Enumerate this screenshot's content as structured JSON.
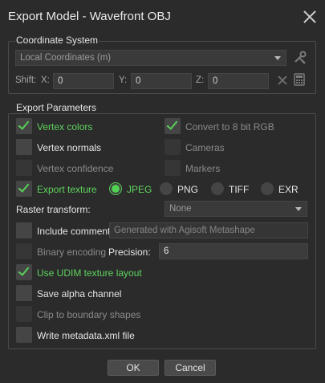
{
  "window": {
    "title": "Export Model - Wavefront OBJ"
  },
  "coordinate_system": {
    "title": "Coordinate System",
    "selected": "Local Coordinates (m)",
    "shift_label": "Shift:",
    "x_label": "X:",
    "x_value": "0",
    "y_label": "Y:",
    "y_value": "0",
    "z_label": "Z:",
    "z_value": "0"
  },
  "export_parameters": {
    "title": "Export Parameters",
    "vertex_colors": {
      "label": "Vertex colors",
      "checked": true
    },
    "convert_8bit": {
      "label": "Convert to 8 bit RGB",
      "checked": true
    },
    "vertex_normals": {
      "label": "Vertex normals",
      "checked": false
    },
    "cameras": {
      "label": "Cameras",
      "checked": false
    },
    "vertex_confidence": {
      "label": "Vertex confidence",
      "checked": false
    },
    "markers": {
      "label": "Markers",
      "checked": false
    },
    "export_texture": {
      "label": "Export texture",
      "checked": true
    },
    "formats": [
      {
        "label": "JPEG",
        "selected": true
      },
      {
        "label": "PNG",
        "selected": false
      },
      {
        "label": "TIFF",
        "selected": false
      },
      {
        "label": "EXR",
        "selected": false
      }
    ],
    "raster_transform_label": "Raster transform:",
    "raster_transform_value": "None",
    "include_comment": {
      "label": "Include comment",
      "checked": false
    },
    "comment_value": "Generated with Agisoft Metashape",
    "binary_encoding": {
      "label": "Binary encoding",
      "checked": false
    },
    "precision_label": "Precision:",
    "precision_value": "6",
    "use_udim": {
      "label": "Use UDIM texture layout",
      "checked": true
    },
    "save_alpha": {
      "label": "Save alpha channel",
      "checked": false
    },
    "clip_boundary": {
      "label": "Clip to boundary shapes",
      "checked": false
    },
    "write_metadata": {
      "label": "Write metadata.xml file",
      "checked": false
    }
  },
  "buttons": {
    "ok": "OK",
    "cancel": "Cancel"
  },
  "colors": {
    "accent_green": "#59d159",
    "background": "#2b2b2b"
  }
}
